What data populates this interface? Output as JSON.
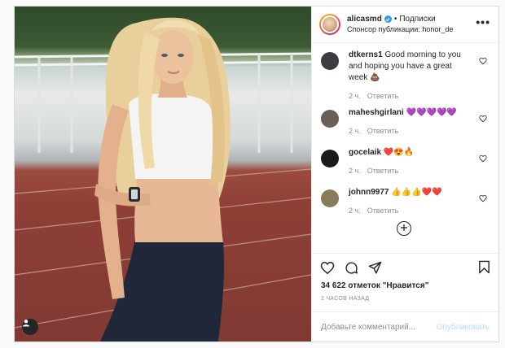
{
  "header": {
    "username": "alicasmd",
    "separator": "•",
    "follow_label": "Подписки",
    "sponsor_prefix": "Спонсор публикации:",
    "sponsor_name": "honor_de",
    "more_label": "•••"
  },
  "comments": [
    {
      "username": "dtkerns1",
      "text": "Good morning to you and hoping you have a great week 💩",
      "time": "2 ч.",
      "reply_label": "Ответить",
      "avatar_color": "#3a3d42"
    },
    {
      "username": "maheshgirlani",
      "text": "💜💜💜💜💜",
      "time": "2 ч.",
      "reply_label": "Ответить",
      "avatar_color": "#6b5e55"
    },
    {
      "username": "gocelaik",
      "text": "❤️😍🔥",
      "time": "2 ч.",
      "reply_label": "Ответить",
      "avatar_color": "#1b1b1b"
    },
    {
      "username": "johnn9977",
      "text": "👍👍👍❤️❤️",
      "time": "2 ч.",
      "reply_label": "Ответить",
      "avatar_color": "#8a7a5c"
    }
  ],
  "likes_text": "34 622 отметок \"Нравится\"",
  "timestamp": "2 ЧАСОВ НАЗАД",
  "add_comment": {
    "placeholder": "Добавьте комментарий...",
    "publish_label": "Опубликовать"
  },
  "colors": {
    "accent": "#3897f0",
    "publish_disabled": "#b2dffc",
    "muted": "#8e8e8e",
    "border": "#dbdbdb"
  },
  "icons": [
    "heart-icon",
    "comment-icon",
    "share-icon",
    "save-icon",
    "more-icon",
    "user-tag-icon",
    "plus-circle-icon",
    "verified-badge-icon"
  ]
}
